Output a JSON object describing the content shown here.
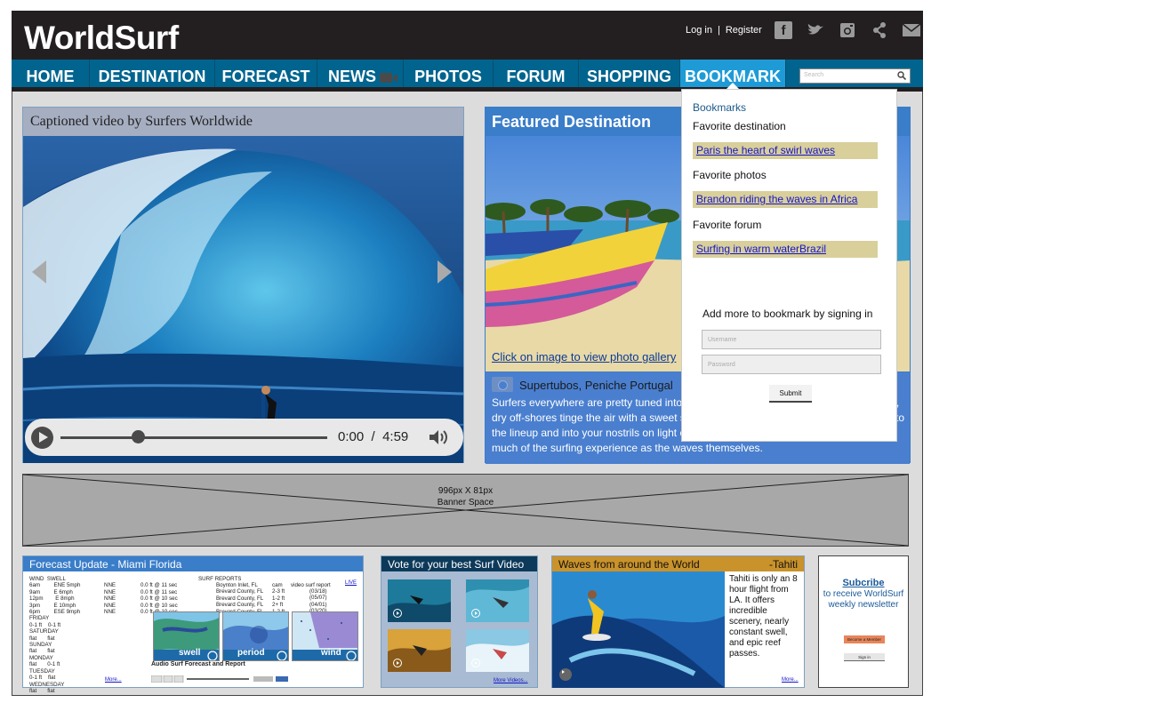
{
  "header": {
    "logo": "WorldSurf",
    "login": "Log in",
    "separator": "|",
    "register": "Register"
  },
  "social_icons": [
    "facebook-icon",
    "twitter-icon",
    "instagram-icon",
    "share-icon",
    "mail-icon"
  ],
  "nav": {
    "items": [
      "HOME",
      "DESTINATION",
      "FORECAST",
      "NEWS",
      "PHOTOS",
      "FORUM",
      "SHOPPING",
      "BOOKMARK"
    ],
    "active": "BOOKMARK",
    "search_placeholder": "Search"
  },
  "video": {
    "caption": "Captioned video by Surfers Worldwide",
    "current_time": "0:00",
    "divider": "/",
    "duration": "4:59",
    "progress": 0.29
  },
  "featured": {
    "title": "Featured Destination",
    "gallery_link": "Click on image to view photo gallery",
    "place": "Supertubos, Peniche Portugal",
    "text": "Surfers everywhere are pretty tuned into the fact that northern Portugal, like California, dry off-shores tinge the air with a sweet scent: the fresh smell of eucalyptus wafts out to the lineup and into your nostrils on light offshore breezes. The smells are almost as much of the surfing experience as the waves themselves."
  },
  "bookmarks": {
    "heading": "Bookmarks",
    "groups": [
      {
        "label": "Favorite destination",
        "link": "Paris the heart of swirl waves"
      },
      {
        "label": "Favorite photos",
        "link": "Brandon riding the waves in Africa"
      },
      {
        "label": "Favorite forum",
        "link": "Surfing in warm waterBrazil "
      }
    ],
    "sign_in_prompt": "Add more to bookmark by signing in",
    "username_placeholder": "Username",
    "password_placeholder": "Password",
    "submit": "Submit"
  },
  "banner": {
    "size": "996px X 81px",
    "label": "Banner Space"
  },
  "forecast": {
    "title": "Forecast Update  - Miami Florida",
    "wind_swell": "WIND  SWELL\n6am         ENE 5mph\n9am         E 6mph\n12pm        E 8mph\n3pm         E 10mph\n6pm         ESE 9mph\nFRIDAY\n0-1 ft    0-1 ft\nSATURDAY\nflat       flat\nSUNDAY\nflat       flat\nMONDAY\nflat       0-1 ft\nTUESDAY\n0-1 ft    flat\nWEDNESDAY\nflat       flat",
    "dirs": "\nNNE\nNNE\nNNE\nNNE\nNNE",
    "heights": "\n0.0 ft @ 11 sec\n0.0 ft @ 11 sec\n0.0 ft @ 10 sec\n0.0 ft @ 10 sec\n0.0 ft @ 10 sec",
    "reports_header": "SURF REPORTS",
    "reports": "Boynton Inlet, FL\nBrevard County, FL\nBrevard County, FL\nBrevard County, FL\nBrevard County, FL",
    "cams": "cam\n2-3 ft\n1-2 ft\n2+ ft\n1-2 ft",
    "video_report_header": "video surf report",
    "video_reports": "(03/18)\n(05/07)\n(04/01)\n(03/20)",
    "live": "LIVE",
    "thumbs": [
      "swell",
      "period",
      "wind"
    ],
    "audio_label": "Audio Surf Forecast and Report",
    "more": "More..."
  },
  "vote": {
    "title": "Vote for your best Surf Video",
    "more": "More Videos..."
  },
  "waves": {
    "title": "Waves from around the World",
    "subtitle": "-Tahiti",
    "text": "Tahiti is only an 8 hour flight from LA. It offers incredible scenery, nearly constant swell, and epic reef passes.",
    "more": "More..."
  },
  "newsletter": {
    "subscribe": "Subcribe",
    "text": "to receive WorldSurf weekly newsletter",
    "button1": "Become a Member",
    "button2": "Sign in"
  }
}
